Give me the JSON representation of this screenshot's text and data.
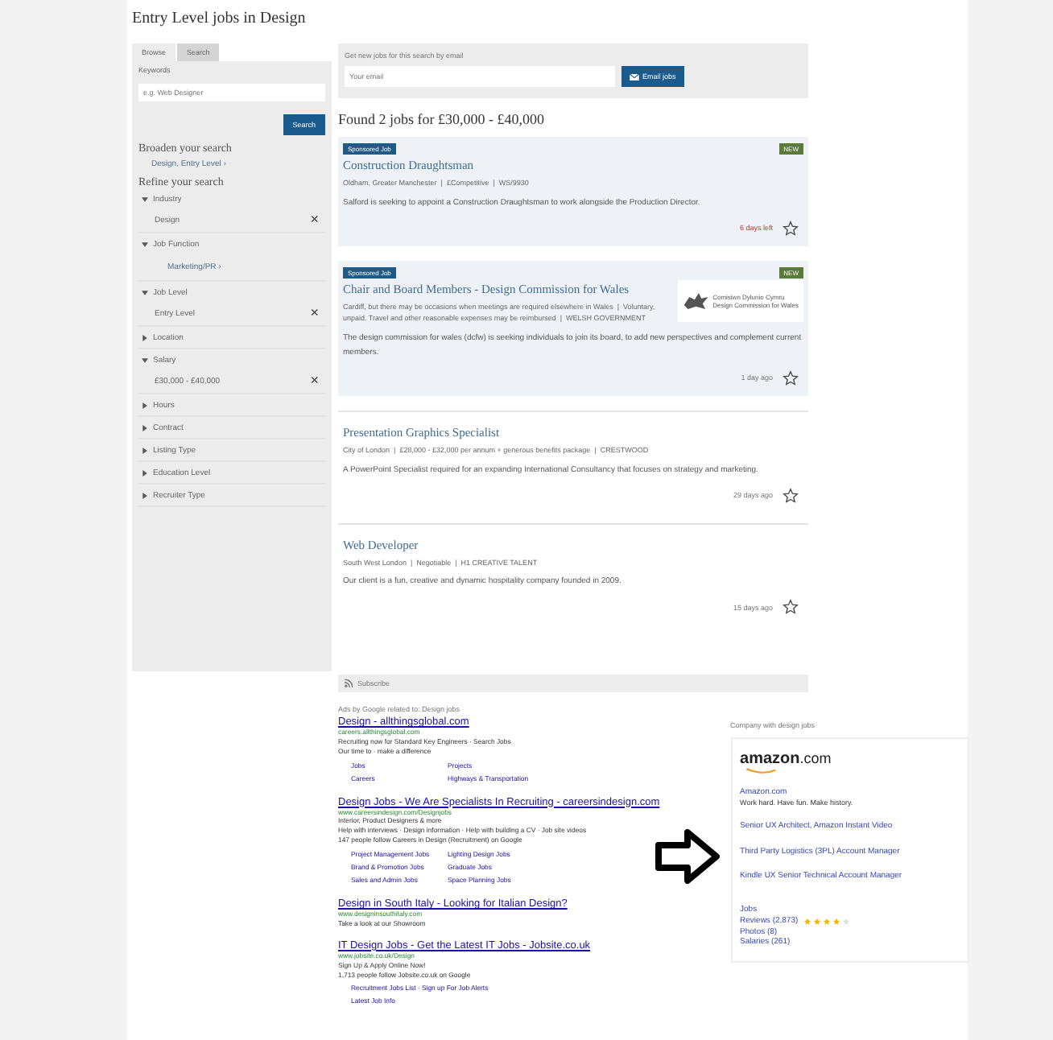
{
  "page_title": "Entry Level jobs in Design",
  "sidebar": {
    "tabs": [
      {
        "label": "Browse",
        "selected": true
      },
      {
        "label": "Search",
        "selected": false
      }
    ],
    "keywords_label": "Keywords",
    "keywords_placeholder": "e.g. Web Designer",
    "search_button": "Search",
    "broaden_heading": "Broaden your search",
    "broaden_link": "Design, Entry Level ›",
    "refine_heading": "Refine your search",
    "facets": [
      {
        "label": "Industry",
        "expanded": true,
        "value": {
          "kind": "selected",
          "text": "Design",
          "remove": "×"
        }
      },
      {
        "label": "Job Function",
        "expanded": true,
        "value": {
          "kind": "link",
          "text": "Marketing/PR ›"
        }
      },
      {
        "label": "Job Level",
        "expanded": true,
        "value": {
          "kind": "selected",
          "text": "Entry Level",
          "remove": "×"
        }
      },
      {
        "label": "Location",
        "expanded": false
      },
      {
        "label": "Salary",
        "expanded": true,
        "value": {
          "kind": "selected",
          "text": "£30,000 - £40,000",
          "remove": "×"
        }
      },
      {
        "label": "Hours",
        "expanded": false
      },
      {
        "label": "Contract",
        "expanded": false
      },
      {
        "label": "Listing Type",
        "expanded": false
      },
      {
        "label": "Education Level",
        "expanded": false
      },
      {
        "label": "Recruiter Type",
        "expanded": false
      }
    ]
  },
  "email_alert": {
    "label": "Get new jobs for this search by email",
    "placeholder": "Your email",
    "button": "Email jobs"
  },
  "results_heading": "Found 2 jobs for £30,000 - £40,000",
  "jobs": [
    {
      "sponsored_tag": "Sponsored Job",
      "badge": "NEW",
      "title": "Construction Draughtsman",
      "meta": "Oldham, Greater Manchester  |  £Competitive  |  WS/9930",
      "description": "Salford is seeking to appoint a Construction Draughtsman to work alongside the Production Director.",
      "time": "6 days left",
      "urgent": true
    },
    {
      "sponsored_tag": "Sponsored Job",
      "badge": "NEW",
      "title": "Chair and Board Members - Design Commission for Wales",
      "meta": "Cardiff, but there may be occasions when meetings are required elsewhere in Wales  |  Voluntary, unpaid. Travel and other reasonable expenses may be reimbursed  |  WELSH GOVERNMENT",
      "description": "The design commission for wales (dcfw) is seeking individuals to join its board, to add new perspectives and complement current members.",
      "time": "1 day ago",
      "urgent": false,
      "logo_lines": [
        "Comisiwn Dylunio Cymru",
        "Design Commission for Wales"
      ]
    },
    {
      "title": "Presentation Graphics Specialist",
      "meta": "City of London  |  £28,000 - £32,000 per annum + generous benefits package  |  CRESTWOOD",
      "description": "A PowerPoint Specialist required for an expanding International Consultancy that focuses on strategy and marketing.",
      "time": "29 days ago",
      "urgent": false
    },
    {
      "title": "Web Developer",
      "meta": "South West London  |  Negotiable  |  H1 CREATIVE TALENT",
      "description": "Our client is a fun, creative and dynamic hospitality company founded in 2009.",
      "time": "15 days ago",
      "urgent": false
    }
  ],
  "ads": {
    "bar_label": "Subscribe",
    "intro": "Ads by Google related to: Design jobs",
    "items": [
      {
        "title": "Design - allthingsglobal.com",
        "url": "careers.allthingsglobal.com",
        "lines": [
          "Recruiting now for Standard Key Engineers · Search Jobs",
          "Our time to · make a difference"
        ],
        "sitelinks": [
          [
            "Jobs",
            "Projects"
          ],
          [
            "Careers",
            "Highways & Transportation"
          ]
        ]
      },
      {
        "title": "Design Jobs - We Are Specialists In Recruiting - careersindesign.com",
        "url": "www.careersindesign.com/Designjobs",
        "lines": [
          "Interior, Product Designers & more",
          "Help with interviews · Design information · Help with building a CV · Job site videos",
          "147 people follow Careers in Design (Recruitment) on Google"
        ],
        "sitelinks": [
          [
            "Project Management Jobs",
            "Lighting Design Jobs"
          ],
          [
            "Brand & Promotion Jobs",
            "Graduate Jobs"
          ],
          [
            "Sales and Admin Jobs",
            "Space Planning Jobs"
          ]
        ]
      },
      {
        "title": "Design in South Italy - Looking for Italian Design?",
        "url": "www.designinsouthitaly.com",
        "lines": [
          "Take a look at our Showroom"
        ]
      },
      {
        "title": "IT Design Jobs - Get the Latest IT Jobs - Jobsite.co.uk",
        "url": "www.jobsite.co.uk/Design",
        "lines": [
          "Sign Up & Apply Online Now!",
          "1,713 people follow Jobsite.co.uk on Google"
        ],
        "sitelinks": [
          [
            "Recruitment Jobs List · Sign up For Job Alerts"
          ],
          [
            "Latest Job Info"
          ]
        ]
      }
    ],
    "company": {
      "heading": "Company with design jobs",
      "logo_text": "amazon",
      "logo_suffix": ".com",
      "name": "Amazon.com",
      "tagline": "Work hard. Have fun. Make history.",
      "links": [
        "Senior UX Architect, Amazon Instant Video",
        "Third Party Logistics (3PL) Account Manager",
        "Kindle UX Senior Technical Account Manager"
      ],
      "jobs_link": "Jobs",
      "reviews_link": "Reviews (2,873)",
      "stars": 4,
      "photos_link": "Photos (8)",
      "salaries_link": "Salaries (261)"
    }
  }
}
